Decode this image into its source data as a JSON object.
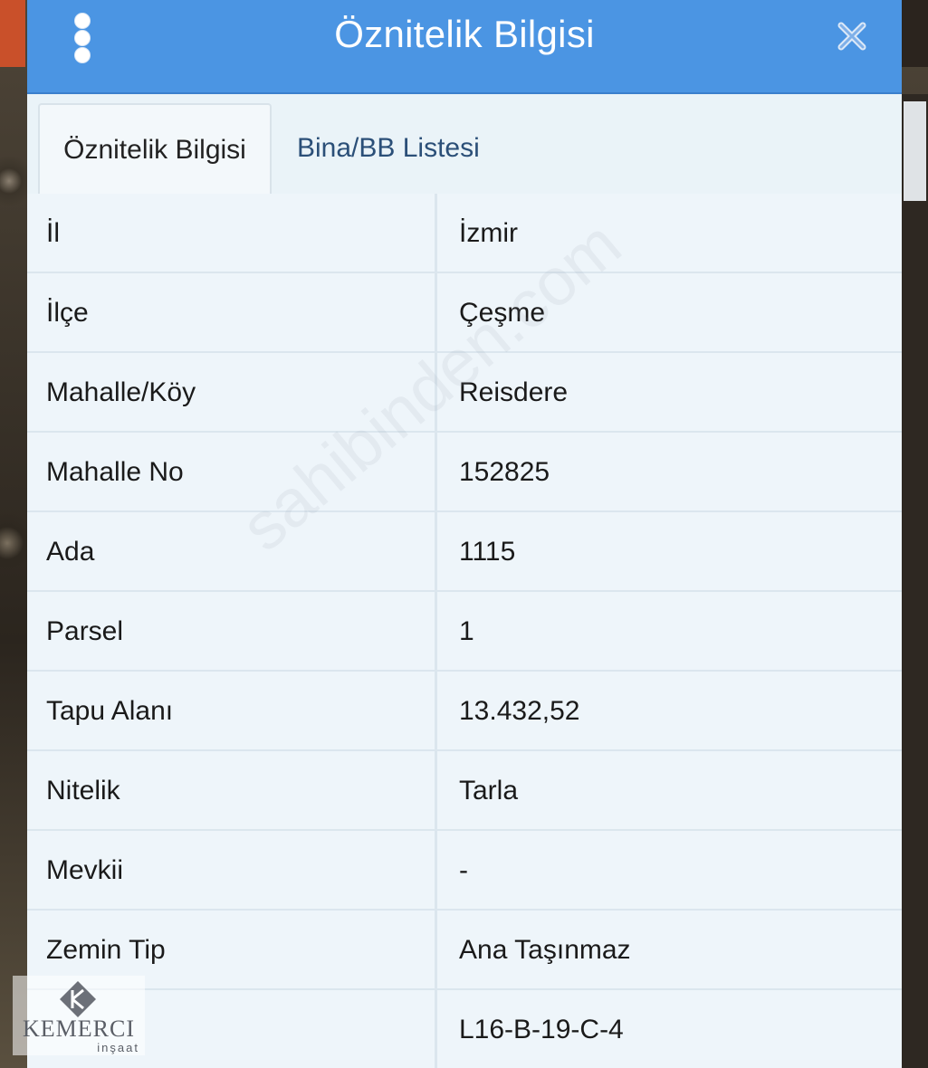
{
  "dialog": {
    "title": "Öznitelik Bilgisi",
    "accent_color": "#4b95e3",
    "menu_icon": "kebab-menu-icon",
    "close_icon": "close-icon"
  },
  "tabs": [
    {
      "label": "Öznitelik Bilgisi",
      "active": true
    },
    {
      "label": "Bina/BB Listesi",
      "active": false
    }
  ],
  "attributes": [
    {
      "key": "İl",
      "value": "İzmir"
    },
    {
      "key": "İlçe",
      "value": "Çeşme"
    },
    {
      "key": "Mahalle/Köy",
      "value": "Reisdere"
    },
    {
      "key": "Mahalle No",
      "value": "152825"
    },
    {
      "key": "Ada",
      "value": "1115"
    },
    {
      "key": "Parsel",
      "value": "1"
    },
    {
      "key": "Tapu Alanı",
      "value": "13.432,52"
    },
    {
      "key": "Nitelik",
      "value": "Tarla"
    },
    {
      "key": "Mevkii",
      "value": "-"
    },
    {
      "key": "Zemin Tip",
      "value": "Ana Taşınmaz"
    },
    {
      "key": "",
      "value": "L16-B-19-C-4"
    }
  ],
  "watermark": "sahibinden.com",
  "logo": {
    "name": "KEMERCI",
    "sub": "inşaat"
  }
}
